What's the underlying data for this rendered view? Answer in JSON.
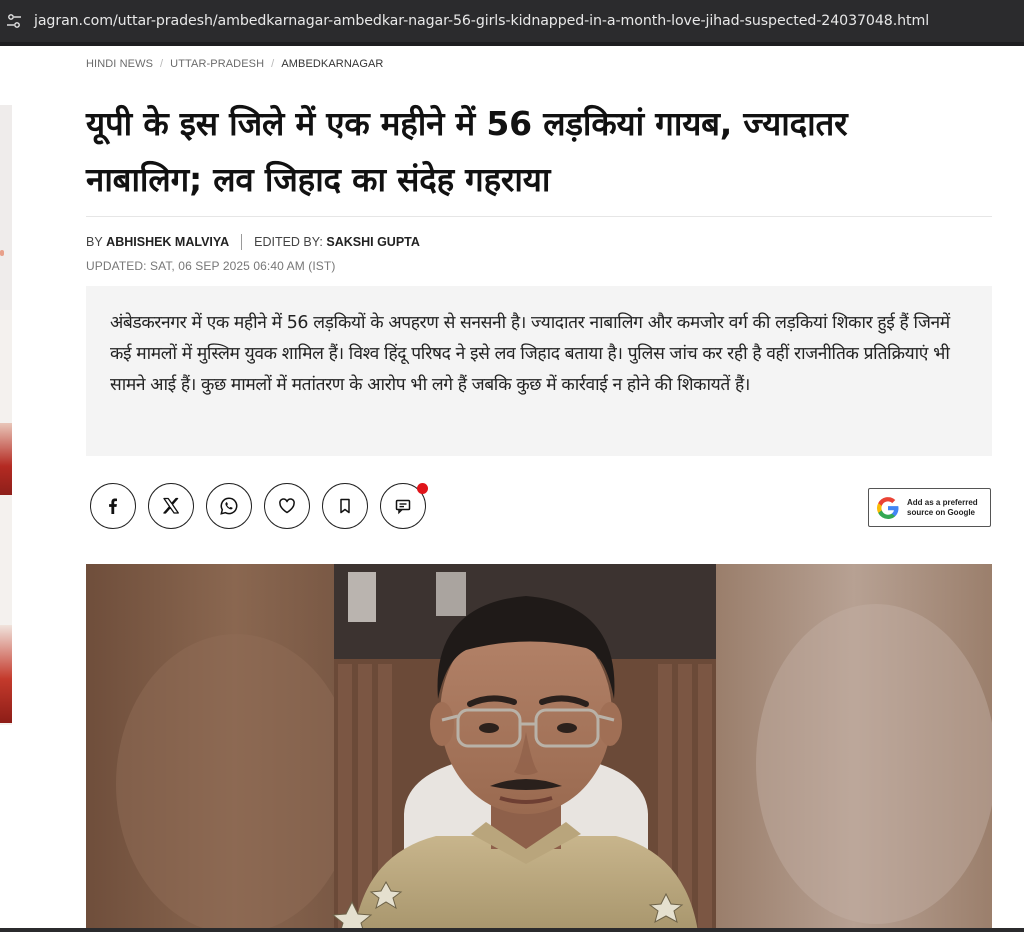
{
  "browser": {
    "url": "jagran.com/uttar-pradesh/ambedkarnagar-ambedkar-nagar-56-girls-kidnapped-in-a-month-love-jihad-suspected-24037048.html",
    "site_info_icon": "tune-icon"
  },
  "breadcrumb": [
    "HINDI NEWS",
    "UTTAR-PRADESH",
    "AMBEDKARNAGAR"
  ],
  "article": {
    "headline_line1": "यूपी के इस जिले में एक महीने में 56 लड़कियां गायब, ज्यादातर",
    "headline_line2": "नाबालिग; लव जिहाद का संदेह गहराया",
    "byline_prefix": "BY",
    "author": "ABHISHEK MALVIYA",
    "edited_prefix": "EDITED BY:",
    "editor": "SAKSHI GUPTA",
    "updated": "UPDATED: SAT, 06 SEP 2025 06:40 AM (IST)",
    "summary": "अंबेडकरनगर में एक महीने में 56 लड़कियों के अपहरण से सनसनी है। ज्यादातर नाबालिग और कमजोर वर्ग की लड़कियां शिकार हुई हैं जिनमें कई मामलों में मुस्लिम युवक शामिल हैं। विश्व हिंदू परिषद ने इसे लव जिहाद बताया है। पुलिस जांच कर रही है वहीं राजनीतिक प्रतिक्रियाएं भी सामने आई हैं। कुछ मामलों में मतांतरण के आरोप भी लगे हैं जबकि कुछ में कार्रवाई न होने की शिकायतें हैं।"
  },
  "share": {
    "buttons": [
      "facebook-icon",
      "x-icon",
      "whatsapp-icon",
      "heart-icon",
      "bookmark-icon",
      "comment-icon"
    ],
    "comment_has_notification": true,
    "notification_color": "#e0141a",
    "google_badge_text": "Add as a preferred source on Google"
  },
  "colors": {
    "text": "#111111",
    "summary_bg": "#f4f4f4",
    "urlbar_bg": "#2b2b2d"
  }
}
